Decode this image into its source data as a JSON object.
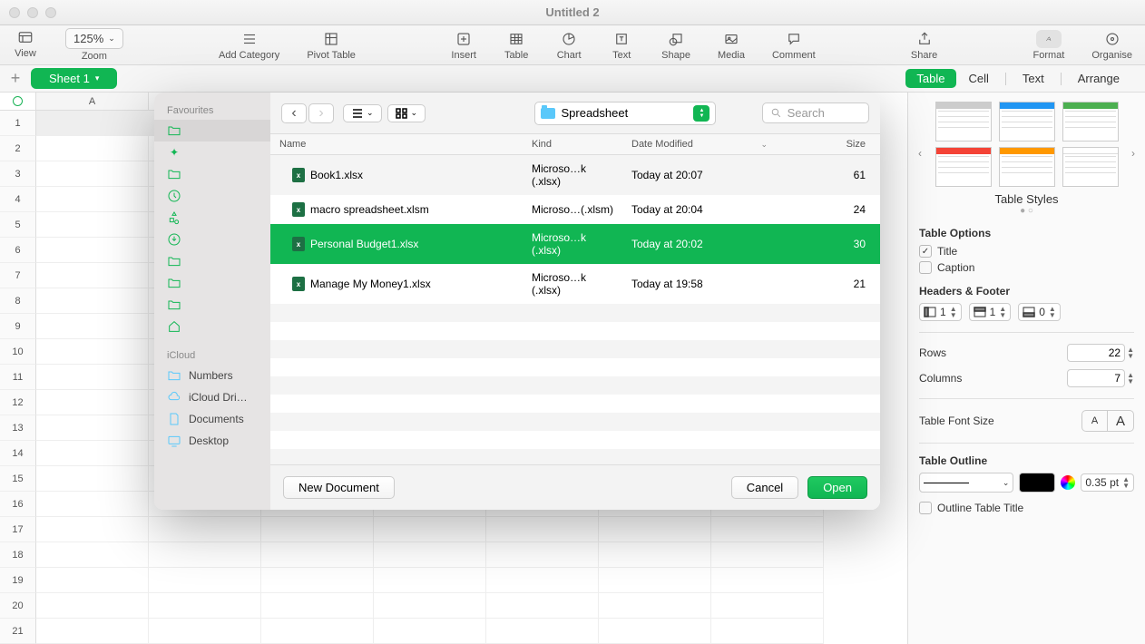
{
  "window": {
    "title": "Untitled 2"
  },
  "toolbar": {
    "view": "View",
    "zoom_label": "Zoom",
    "zoom_value": "125%",
    "add_category": "Add Category",
    "pivot": "Pivot Table",
    "insert": "Insert",
    "table": "Table",
    "chart": "Chart",
    "text": "Text",
    "shape": "Shape",
    "media": "Media",
    "comment": "Comment",
    "share": "Share",
    "format": "Format",
    "organise": "Organise"
  },
  "sheet_tab": "Sheet 1",
  "inspector_tabs": [
    "Table",
    "Cell",
    "Text",
    "Arrange"
  ],
  "column_header": "A",
  "inspector": {
    "styles_title": "Table Styles",
    "options_title": "Table Options",
    "opt_title": "Title",
    "opt_caption": "Caption",
    "headers_title": "Headers & Footer",
    "header_cols": "1",
    "header_rows": "1",
    "footer_rows": "0",
    "rows_label": "Rows",
    "rows_value": "22",
    "cols_label": "Columns",
    "cols_value": "7",
    "font_title": "Table Font Size",
    "outline_title": "Table Outline",
    "outline_pt": "0.35 pt",
    "outline_opt": "Outline Table Title"
  },
  "dialog": {
    "sidebar": {
      "favourites": "Favourites",
      "icloud": "iCloud",
      "items": [
        "Numbers",
        "iCloud Dri…",
        "Documents",
        "Desktop"
      ]
    },
    "location": "Spreadsheet",
    "search_placeholder": "Search",
    "columns": {
      "name": "Name",
      "kind": "Kind",
      "date": "Date Modified",
      "size": "Size"
    },
    "files": [
      {
        "name": "Book1.xlsx",
        "kind": "Microso…k (.xlsx)",
        "date": "Today at 20:07",
        "size": "61"
      },
      {
        "name": "macro spreadsheet.xlsm",
        "kind": "Microso…(.xlsm)",
        "date": "Today at 20:04",
        "size": "24"
      },
      {
        "name": "Personal Budget1.xlsx",
        "kind": "Microso…k (.xlsx)",
        "date": "Today at 20:02",
        "size": "30",
        "selected": true
      },
      {
        "name": "Manage My Money1.xlsx",
        "kind": "Microso…k (.xlsx)",
        "date": "Today at 19:58",
        "size": "21"
      }
    ],
    "new_doc": "New Document",
    "cancel": "Cancel",
    "open": "Open"
  }
}
